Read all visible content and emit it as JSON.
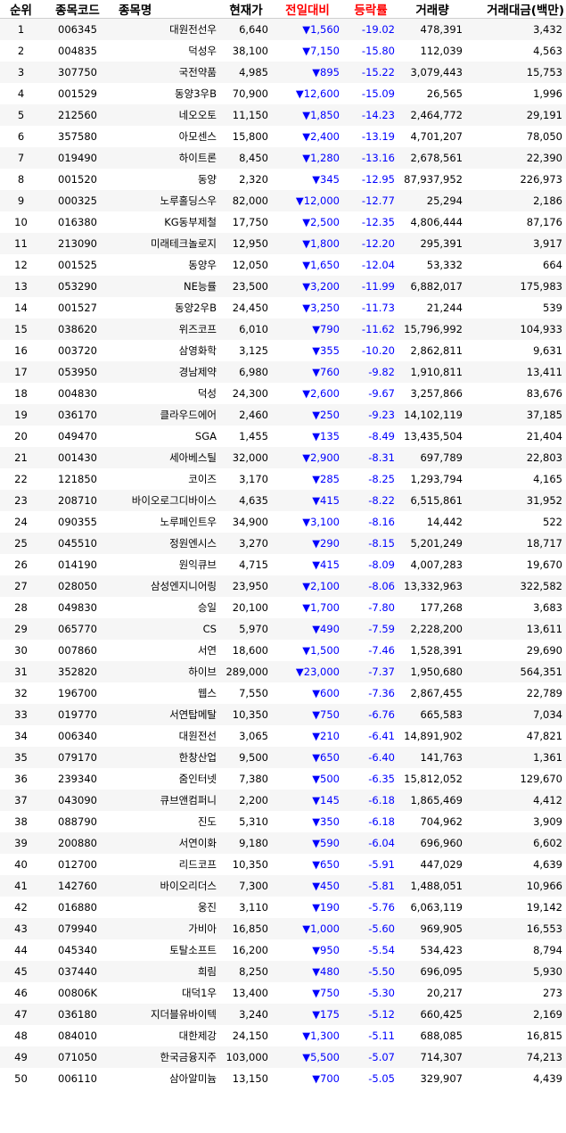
{
  "headers": {
    "rank": "순위",
    "code": "종목코드",
    "name": "종목명",
    "price": "현재가",
    "change": "전일대비",
    "rate": "등락률",
    "volume": "거래량",
    "amount": "거래대금(백만)"
  },
  "colors": {
    "header_highlight": "#ff0000",
    "down": "#0000ff",
    "row_alt": "#f6f6f6"
  },
  "rows": [
    {
      "rank": "1",
      "code": "006345",
      "name": "대원전선우",
      "price": "6,640",
      "change": "▼1,560",
      "rate": "-19.02",
      "volume": "478,391",
      "amount": "3,432"
    },
    {
      "rank": "2",
      "code": "004835",
      "name": "덕성우",
      "price": "38,100",
      "change": "▼7,150",
      "rate": "-15.80",
      "volume": "112,039",
      "amount": "4,563"
    },
    {
      "rank": "3",
      "code": "307750",
      "name": "국전약품",
      "price": "4,985",
      "change": "▼895",
      "rate": "-15.22",
      "volume": "3,079,443",
      "amount": "15,753"
    },
    {
      "rank": "4",
      "code": "001529",
      "name": "동양3우B",
      "price": "70,900",
      "change": "▼12,600",
      "rate": "-15.09",
      "volume": "26,565",
      "amount": "1,996"
    },
    {
      "rank": "5",
      "code": "212560",
      "name": "네오오토",
      "price": "11,150",
      "change": "▼1,850",
      "rate": "-14.23",
      "volume": "2,464,772",
      "amount": "29,191"
    },
    {
      "rank": "6",
      "code": "357580",
      "name": "아모센스",
      "price": "15,800",
      "change": "▼2,400",
      "rate": "-13.19",
      "volume": "4,701,207",
      "amount": "78,050"
    },
    {
      "rank": "7",
      "code": "019490",
      "name": "하이트론",
      "price": "8,450",
      "change": "▼1,280",
      "rate": "-13.16",
      "volume": "2,678,561",
      "amount": "22,390"
    },
    {
      "rank": "8",
      "code": "001520",
      "name": "동양",
      "price": "2,320",
      "change": "▼345",
      "rate": "-12.95",
      "volume": "87,937,952",
      "amount": "226,973"
    },
    {
      "rank": "9",
      "code": "000325",
      "name": "노루홀딩스우",
      "price": "82,000",
      "change": "▼12,000",
      "rate": "-12.77",
      "volume": "25,294",
      "amount": "2,186"
    },
    {
      "rank": "10",
      "code": "016380",
      "name": "KG동부제철",
      "price": "17,750",
      "change": "▼2,500",
      "rate": "-12.35",
      "volume": "4,806,444",
      "amount": "87,176"
    },
    {
      "rank": "11",
      "code": "213090",
      "name": "미래테크놀로지",
      "price": "12,950",
      "change": "▼1,800",
      "rate": "-12.20",
      "volume": "295,391",
      "amount": "3,917"
    },
    {
      "rank": "12",
      "code": "001525",
      "name": "동양우",
      "price": "12,050",
      "change": "▼1,650",
      "rate": "-12.04",
      "volume": "53,332",
      "amount": "664"
    },
    {
      "rank": "13",
      "code": "053290",
      "name": "NE능률",
      "price": "23,500",
      "change": "▼3,200",
      "rate": "-11.99",
      "volume": "6,882,017",
      "amount": "175,983"
    },
    {
      "rank": "14",
      "code": "001527",
      "name": "동양2우B",
      "price": "24,450",
      "change": "▼3,250",
      "rate": "-11.73",
      "volume": "21,244",
      "amount": "539"
    },
    {
      "rank": "15",
      "code": "038620",
      "name": "위즈코프",
      "price": "6,010",
      "change": "▼790",
      "rate": "-11.62",
      "volume": "15,796,992",
      "amount": "104,933"
    },
    {
      "rank": "16",
      "code": "003720",
      "name": "삼영화학",
      "price": "3,125",
      "change": "▼355",
      "rate": "-10.20",
      "volume": "2,862,811",
      "amount": "9,631"
    },
    {
      "rank": "17",
      "code": "053950",
      "name": "경남제약",
      "price": "6,980",
      "change": "▼760",
      "rate": "-9.82",
      "volume": "1,910,811",
      "amount": "13,411"
    },
    {
      "rank": "18",
      "code": "004830",
      "name": "덕성",
      "price": "24,300",
      "change": "▼2,600",
      "rate": "-9.67",
      "volume": "3,257,866",
      "amount": "83,676"
    },
    {
      "rank": "19",
      "code": "036170",
      "name": "클라우드에어",
      "price": "2,460",
      "change": "▼250",
      "rate": "-9.23",
      "volume": "14,102,119",
      "amount": "37,185"
    },
    {
      "rank": "20",
      "code": "049470",
      "name": "SGA",
      "price": "1,455",
      "change": "▼135",
      "rate": "-8.49",
      "volume": "13,435,504",
      "amount": "21,404"
    },
    {
      "rank": "21",
      "code": "001430",
      "name": "세아베스틸",
      "price": "32,000",
      "change": "▼2,900",
      "rate": "-8.31",
      "volume": "697,789",
      "amount": "22,803"
    },
    {
      "rank": "22",
      "code": "121850",
      "name": "코이즈",
      "price": "3,170",
      "change": "▼285",
      "rate": "-8.25",
      "volume": "1,293,794",
      "amount": "4,165"
    },
    {
      "rank": "23",
      "code": "208710",
      "name": "바이오로그디바이스",
      "price": "4,635",
      "change": "▼415",
      "rate": "-8.22",
      "volume": "6,515,861",
      "amount": "31,952"
    },
    {
      "rank": "24",
      "code": "090355",
      "name": "노루페인트우",
      "price": "34,900",
      "change": "▼3,100",
      "rate": "-8.16",
      "volume": "14,442",
      "amount": "522"
    },
    {
      "rank": "25",
      "code": "045510",
      "name": "정원엔시스",
      "price": "3,270",
      "change": "▼290",
      "rate": "-8.15",
      "volume": "5,201,249",
      "amount": "18,717"
    },
    {
      "rank": "26",
      "code": "014190",
      "name": "원익큐브",
      "price": "4,715",
      "change": "▼415",
      "rate": "-8.09",
      "volume": "4,007,283",
      "amount": "19,670"
    },
    {
      "rank": "27",
      "code": "028050",
      "name": "삼성엔지니어링",
      "price": "23,950",
      "change": "▼2,100",
      "rate": "-8.06",
      "volume": "13,332,963",
      "amount": "322,582"
    },
    {
      "rank": "28",
      "code": "049830",
      "name": "승일",
      "price": "20,100",
      "change": "▼1,700",
      "rate": "-7.80",
      "volume": "177,268",
      "amount": "3,683"
    },
    {
      "rank": "29",
      "code": "065770",
      "name": "CS",
      "price": "5,970",
      "change": "▼490",
      "rate": "-7.59",
      "volume": "2,228,200",
      "amount": "13,611"
    },
    {
      "rank": "30",
      "code": "007860",
      "name": "서연",
      "price": "18,600",
      "change": "▼1,500",
      "rate": "-7.46",
      "volume": "1,528,391",
      "amount": "29,690"
    },
    {
      "rank": "31",
      "code": "352820",
      "name": "하이브",
      "price": "289,000",
      "change": "▼23,000",
      "rate": "-7.37",
      "volume": "1,950,680",
      "amount": "564,351"
    },
    {
      "rank": "32",
      "code": "196700",
      "name": "웹스",
      "price": "7,550",
      "change": "▼600",
      "rate": "-7.36",
      "volume": "2,867,455",
      "amount": "22,789"
    },
    {
      "rank": "33",
      "code": "019770",
      "name": "서연탑메탈",
      "price": "10,350",
      "change": "▼750",
      "rate": "-6.76",
      "volume": "665,583",
      "amount": "7,034"
    },
    {
      "rank": "34",
      "code": "006340",
      "name": "대원전선",
      "price": "3,065",
      "change": "▼210",
      "rate": "-6.41",
      "volume": "14,891,902",
      "amount": "47,821"
    },
    {
      "rank": "35",
      "code": "079170",
      "name": "한창산업",
      "price": "9,500",
      "change": "▼650",
      "rate": "-6.40",
      "volume": "141,763",
      "amount": "1,361"
    },
    {
      "rank": "36",
      "code": "239340",
      "name": "줌인터넷",
      "price": "7,380",
      "change": "▼500",
      "rate": "-6.35",
      "volume": "15,812,052",
      "amount": "129,670"
    },
    {
      "rank": "37",
      "code": "043090",
      "name": "큐브앤컴퍼니",
      "price": "2,200",
      "change": "▼145",
      "rate": "-6.18",
      "volume": "1,865,469",
      "amount": "4,412"
    },
    {
      "rank": "38",
      "code": "088790",
      "name": "진도",
      "price": "5,310",
      "change": "▼350",
      "rate": "-6.18",
      "volume": "704,962",
      "amount": "3,909"
    },
    {
      "rank": "39",
      "code": "200880",
      "name": "서연이화",
      "price": "9,180",
      "change": "▼590",
      "rate": "-6.04",
      "volume": "696,960",
      "amount": "6,602"
    },
    {
      "rank": "40",
      "code": "012700",
      "name": "리드코프",
      "price": "10,350",
      "change": "▼650",
      "rate": "-5.91",
      "volume": "447,029",
      "amount": "4,639"
    },
    {
      "rank": "41",
      "code": "142760",
      "name": "바이오리더스",
      "price": "7,300",
      "change": "▼450",
      "rate": "-5.81",
      "volume": "1,488,051",
      "amount": "10,966"
    },
    {
      "rank": "42",
      "code": "016880",
      "name": "웅진",
      "price": "3,110",
      "change": "▼190",
      "rate": "-5.76",
      "volume": "6,063,119",
      "amount": "19,142"
    },
    {
      "rank": "43",
      "code": "079940",
      "name": "가비아",
      "price": "16,850",
      "change": "▼1,000",
      "rate": "-5.60",
      "volume": "969,905",
      "amount": "16,553"
    },
    {
      "rank": "44",
      "code": "045340",
      "name": "토탈소프트",
      "price": "16,200",
      "change": "▼950",
      "rate": "-5.54",
      "volume": "534,423",
      "amount": "8,794"
    },
    {
      "rank": "45",
      "code": "037440",
      "name": "희림",
      "price": "8,250",
      "change": "▼480",
      "rate": "-5.50",
      "volume": "696,095",
      "amount": "5,930"
    },
    {
      "rank": "46",
      "code": "00806K",
      "name": "대덕1우",
      "price": "13,400",
      "change": "▼750",
      "rate": "-5.30",
      "volume": "20,217",
      "amount": "273"
    },
    {
      "rank": "47",
      "code": "036180",
      "name": "지더블유바이텍",
      "price": "3,240",
      "change": "▼175",
      "rate": "-5.12",
      "volume": "660,425",
      "amount": "2,169"
    },
    {
      "rank": "48",
      "code": "084010",
      "name": "대한제강",
      "price": "24,150",
      "change": "▼1,300",
      "rate": "-5.11",
      "volume": "688,085",
      "amount": "16,815"
    },
    {
      "rank": "49",
      "code": "071050",
      "name": "한국금융지주",
      "price": "103,000",
      "change": "▼5,500",
      "rate": "-5.07",
      "volume": "714,307",
      "amount": "74,213"
    },
    {
      "rank": "50",
      "code": "006110",
      "name": "삼아알미늄",
      "price": "13,150",
      "change": "▼700",
      "rate": "-5.05",
      "volume": "329,907",
      "amount": "4,439"
    }
  ]
}
